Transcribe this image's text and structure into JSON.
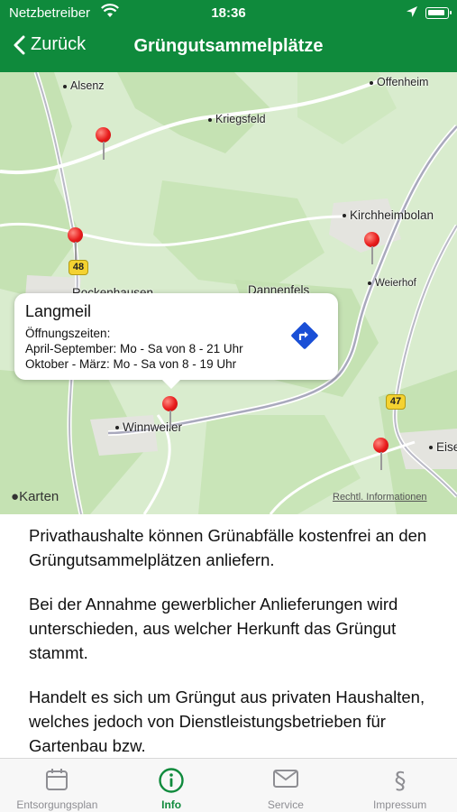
{
  "status_bar": {
    "carrier": "Netzbetreiber",
    "time": "18:36"
  },
  "nav": {
    "back_label": "Zurück",
    "title": "Grüngutsammelplätze"
  },
  "map": {
    "places": [
      "Alsenz",
      "Offenheim",
      "Kriegsfeld",
      "Kirchheimbolan",
      "Weierhof",
      "Rockenhausen",
      "Dannenfels",
      "Winnweiler",
      "Eise"
    ],
    "road_shields": [
      "48",
      "47"
    ],
    "callout": {
      "title": "Langmeil",
      "line1": "Öffnungszeiten:",
      "line2": "April-September: Mo - Sa von 8 - 21 Uhr",
      "line3": "Oktober - März: Mo - Sa von 8 - 19 Uhr"
    },
    "brand": "Karten",
    "legal": "Rechtl. Informationen"
  },
  "content": {
    "paragraphs": [
      "Privathaushalte können Grünabfälle kostenfrei an den Grüngutsammelplätzen anliefern.",
      "Bei der Annahme gewerblicher Anlieferungen wird unterschieden, aus welcher Herkunft das Grüngut stammt.",
      "Handelt es sich um Grüngut aus privaten Haushalten, welches jedoch von Dienstleistungsbetrieben für Gartenbau bzw."
    ]
  },
  "tabs": [
    {
      "label": "Entsorgungsplan",
      "icon": "calendar-icon"
    },
    {
      "label": "Info",
      "icon": "info-icon",
      "active": true
    },
    {
      "label": "Service",
      "icon": "envelope-icon"
    },
    {
      "label": "Impressum",
      "icon": "section-sign-icon"
    }
  ],
  "colors": {
    "brand_green": "#0f8a3c",
    "pin_red": "#e81c1c",
    "inactive_tab": "#8e8e93",
    "route_blue": "#1a4fd6"
  }
}
